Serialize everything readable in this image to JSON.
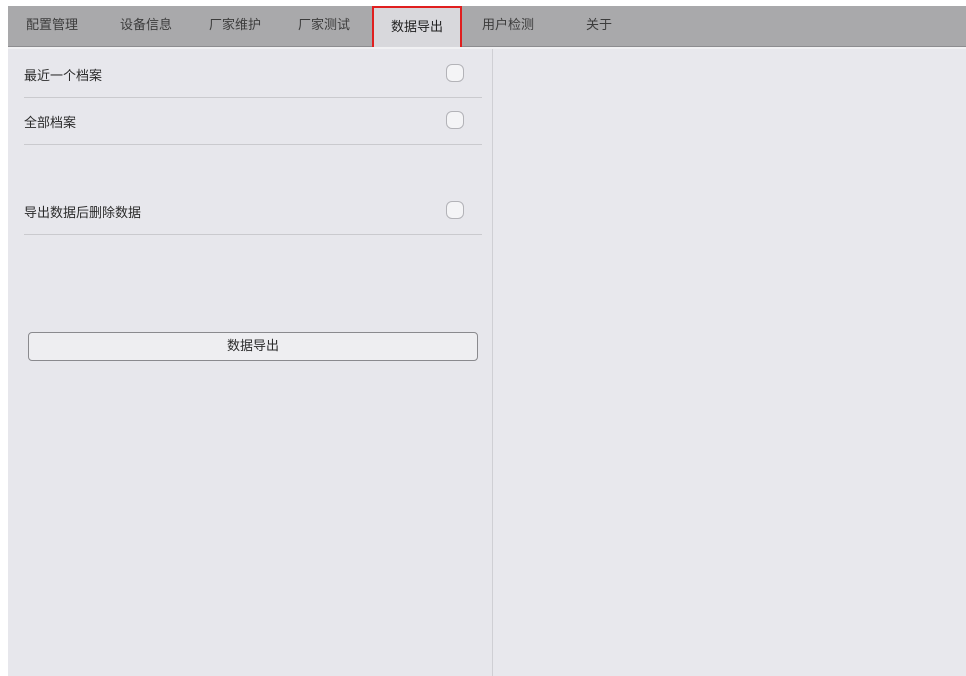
{
  "tabs": [
    {
      "label": "配置管理"
    },
    {
      "label": "设备信息"
    },
    {
      "label": "厂家维护"
    },
    {
      "label": "厂家测试"
    },
    {
      "label": "数据导出"
    },
    {
      "label": "用户检测"
    },
    {
      "label": "关于"
    }
  ],
  "active_tab": "数据导出",
  "options": {
    "recent_file": {
      "label": "最近一个档案",
      "checked": false
    },
    "all_files": {
      "label": "全部档案",
      "checked": false
    },
    "delete_after_export": {
      "label": "导出数据后删除数据",
      "checked": false
    }
  },
  "export_button": {
    "label": "数据导出"
  }
}
